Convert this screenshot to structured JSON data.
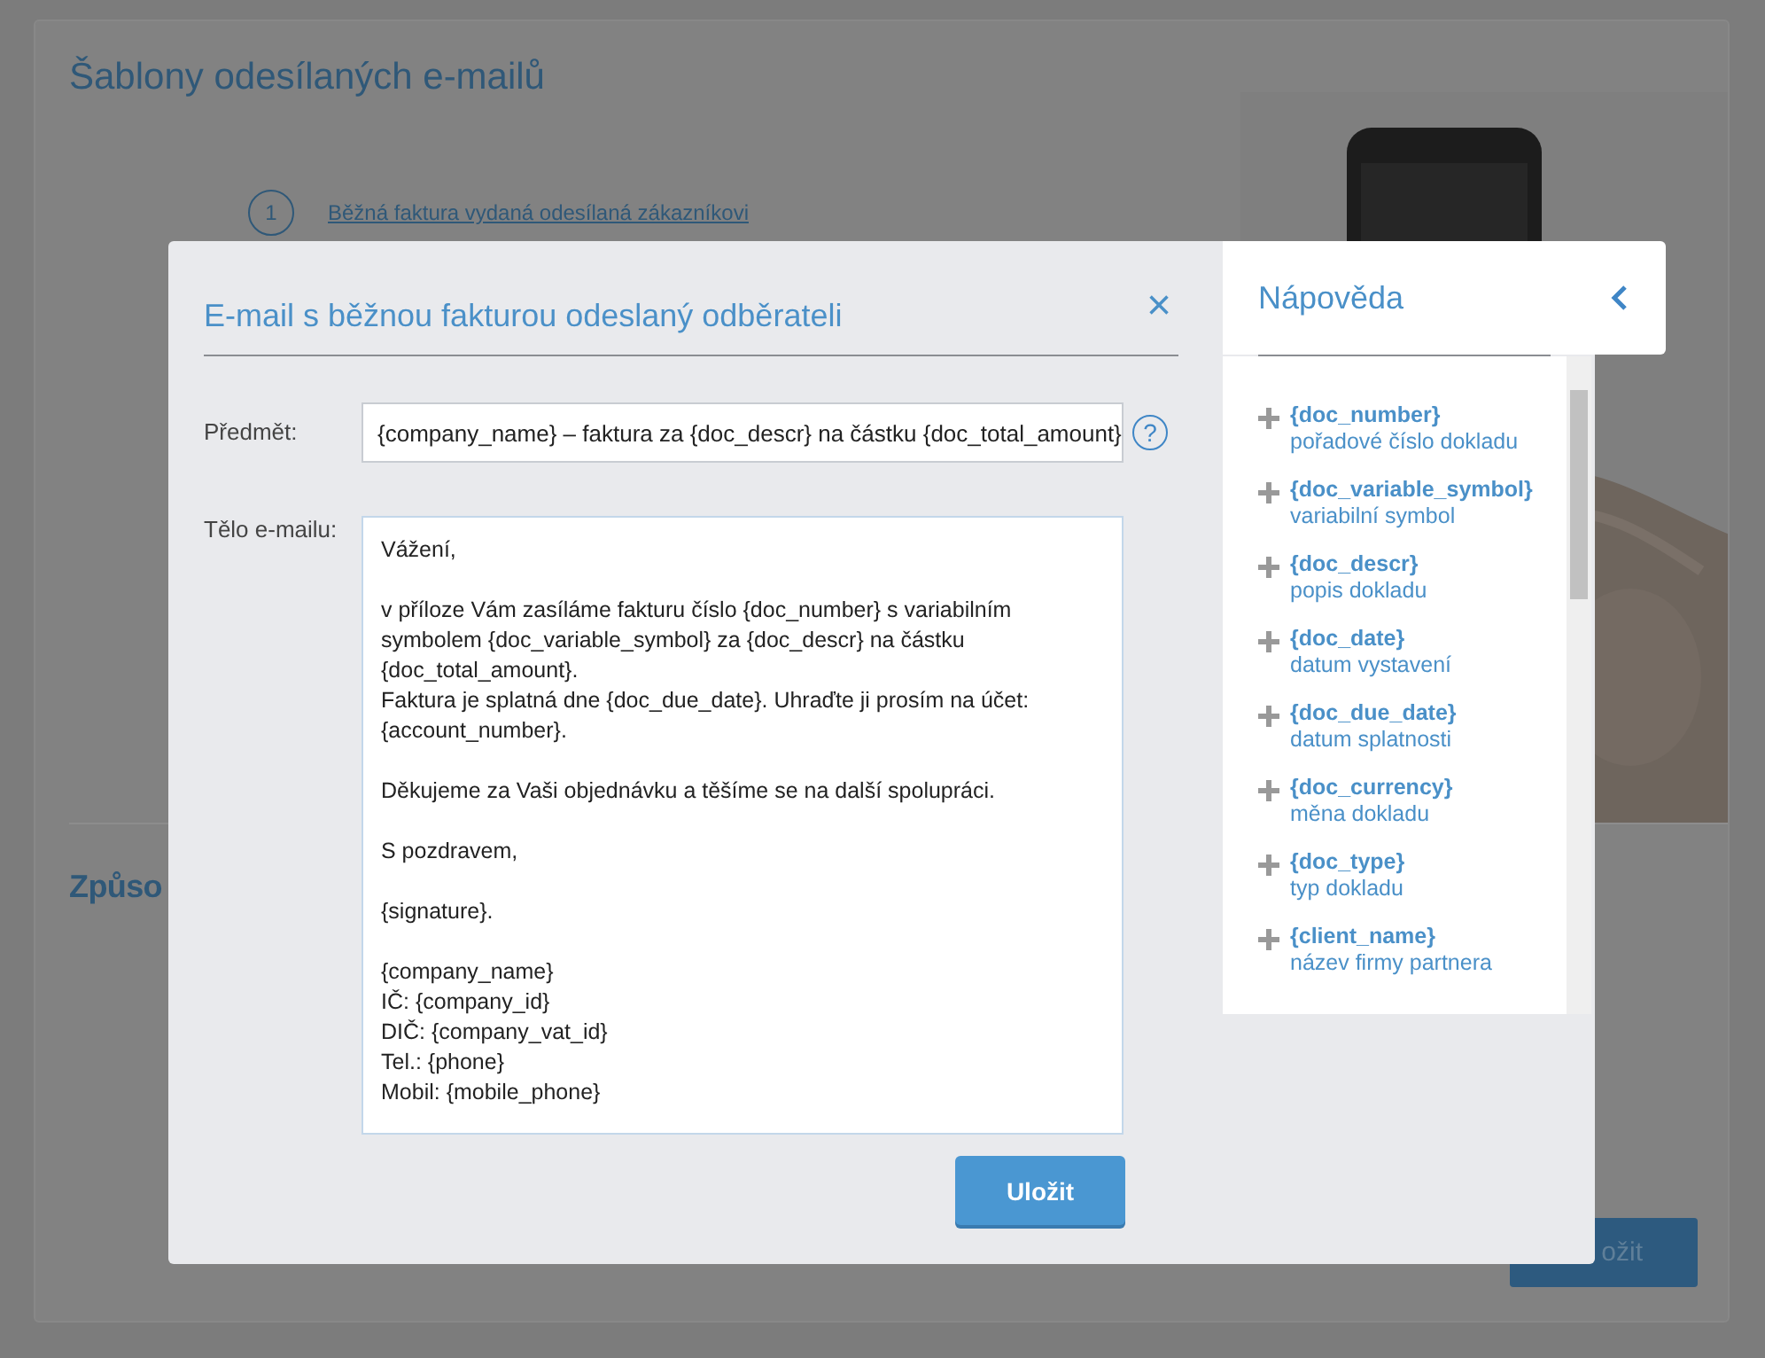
{
  "page": {
    "title": "Šablony odesílaných e-mailů",
    "step_number": "1",
    "step_link": "Běžná faktura vydaná odesílaná zákazníkovi",
    "section_title": "Způso",
    "save_button": "ožit"
  },
  "dialog": {
    "title": "E-mail s běžnou fakturou odeslaný odběrateli",
    "close": "×",
    "subject_label": "Předmět:",
    "subject_value": "{company_name} – faktura za {doc_descr} na částku {doc_total_amount}",
    "help": "?",
    "body_label": "Tělo e-mailu:",
    "body": [
      [
        "Vážení,"
      ],
      [
        "v příloze Vám zasíláme fakturu číslo {doc_number} s variabilním symbolem {doc_variable_symbol} za {doc_descr} na částku {doc_total_amount}.",
        "Faktura je splatná dne {doc_due_date}. Uhraďte ji prosím na účet: {account_number}."
      ],
      [
        "Děkujeme za Vaši objednávku a těšíme se na další spolupráci."
      ],
      [
        "S pozdravem,"
      ],
      [
        "{signature}."
      ],
      [
        "{company_name}",
        "IČ: {company_id}",
        "DIČ: {company_vat_id}",
        "Tel.: {phone}",
        "Mobil: {mobile_phone}"
      ]
    ],
    "save_button": "Uložit"
  },
  "help_panel": {
    "title": "Nápověda",
    "items": [
      {
        "name": "{doc_number}",
        "description": "pořadové číslo dokladu"
      },
      {
        "name": "{doc_variable_symbol}",
        "description": "variabilní symbol"
      },
      {
        "name": "{doc_descr}",
        "description": "popis dokladu"
      },
      {
        "name": "{doc_date}",
        "description": "datum vystavení"
      },
      {
        "name": "{doc_due_date}",
        "description": "datum splatnosti"
      },
      {
        "name": "{doc_currency}",
        "description": "měna dokladu"
      },
      {
        "name": "{doc_type}",
        "description": "typ dokladu"
      },
      {
        "name": "{client_name}",
        "description": "název firmy partnera"
      }
    ]
  }
}
